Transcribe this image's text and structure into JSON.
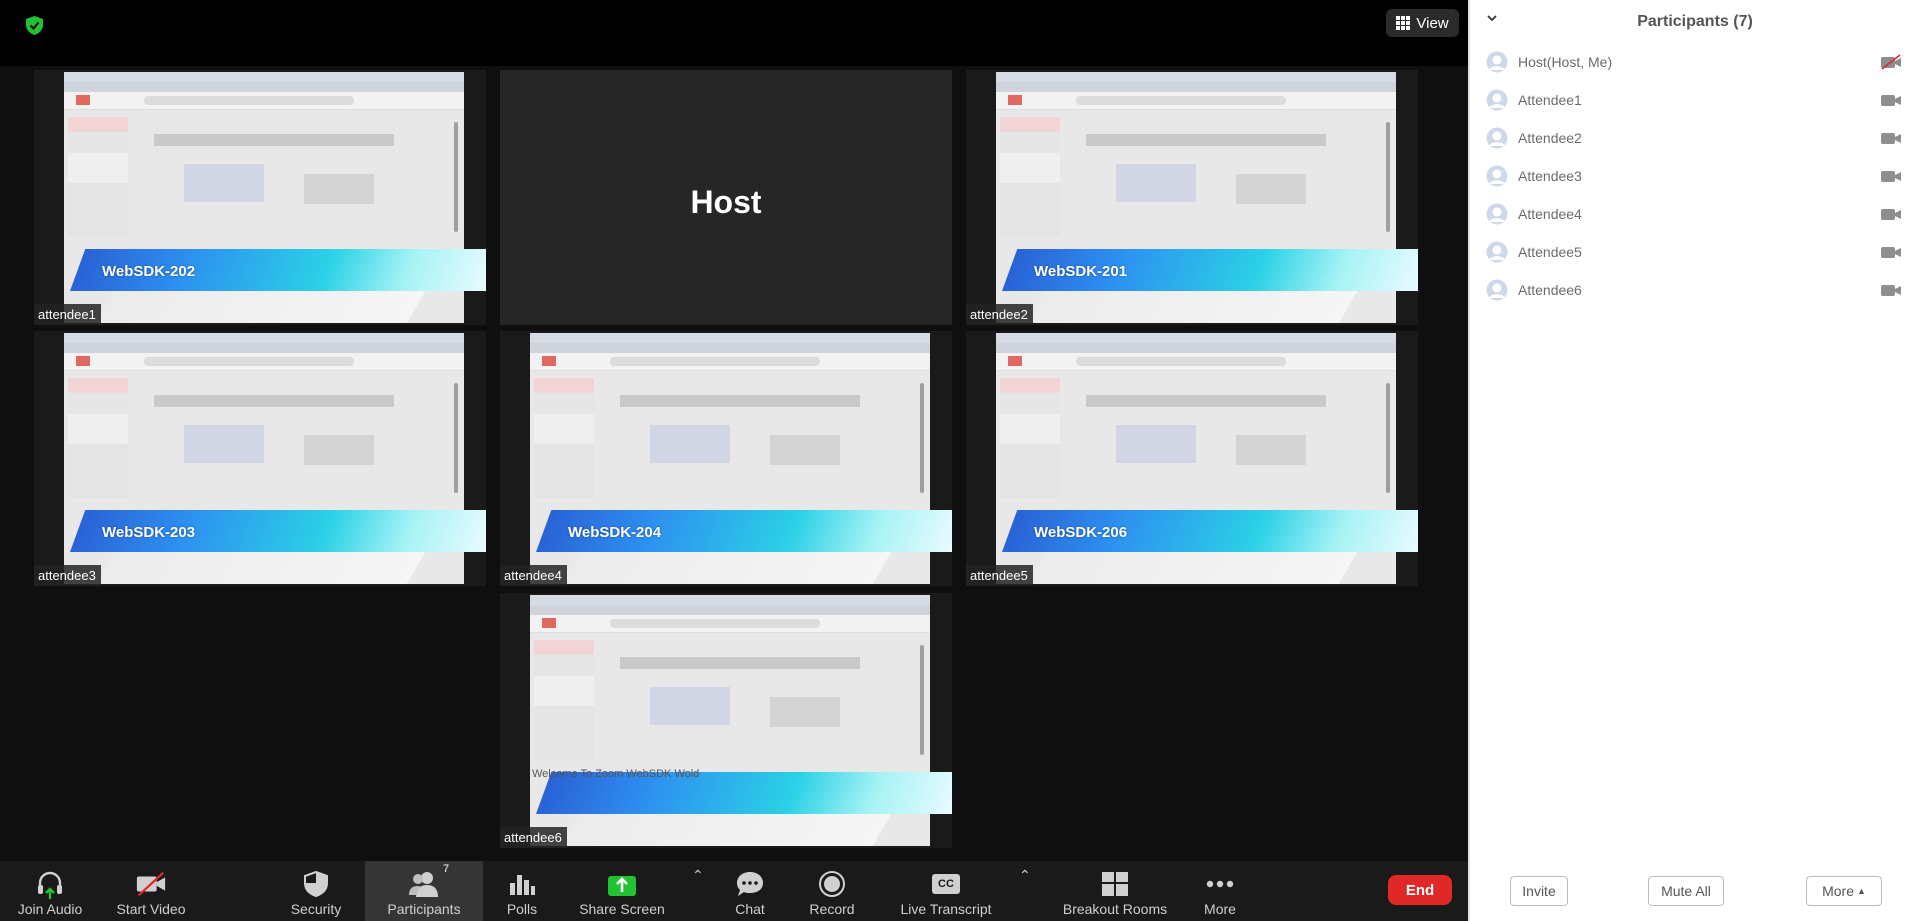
{
  "topbar": {
    "view_label": "View"
  },
  "tiles": [
    {
      "name": "attendee1",
      "banner": "WebSDK-202"
    },
    {
      "name": "Host",
      "banner": ""
    },
    {
      "name": "attendee2",
      "banner": "WebSDK-201"
    },
    {
      "name": "attendee3",
      "banner": "WebSDK-203"
    },
    {
      "name": "attendee4",
      "banner": "WebSDK-204"
    },
    {
      "name": "attendee5",
      "banner": "WebSDK-206"
    },
    {
      "name": "attendee6",
      "banner": "",
      "caption": "Welcome To Zoom WebSDK Wold"
    }
  ],
  "toolbar": {
    "join_audio": "Join Audio",
    "start_video": "Start Video",
    "security": "Security",
    "participants": "Participants",
    "participants_count": "7",
    "polls": "Polls",
    "share_screen": "Share Screen",
    "chat": "Chat",
    "record": "Record",
    "live_transcript": "Live Transcript",
    "cc": "CC",
    "breakout_rooms": "Breakout Rooms",
    "more": "More",
    "end": "End"
  },
  "panel": {
    "title": "Participants (7)",
    "participants": [
      {
        "name": "Host(Host, Me)",
        "video": "off"
      },
      {
        "name": "Attendee1",
        "video": "on"
      },
      {
        "name": "Attendee2",
        "video": "on"
      },
      {
        "name": "Attendee3",
        "video": "on"
      },
      {
        "name": "Attendee4",
        "video": "on"
      },
      {
        "name": "Attendee5",
        "video": "on"
      },
      {
        "name": "Attendee6",
        "video": "on"
      }
    ],
    "invite": "Invite",
    "mute_all": "Mute All",
    "more": "More"
  },
  "colors": {
    "end": "#e02828",
    "share": "#22c332",
    "security_shield": "#22c332"
  }
}
